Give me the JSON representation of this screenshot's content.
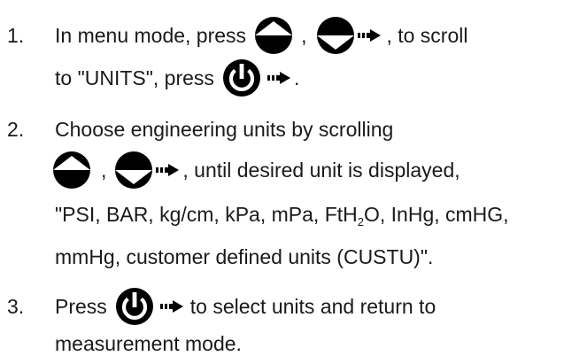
{
  "steps": [
    {
      "number": "1.",
      "line1": {
        "text_a": "In menu mode, press",
        "sep": ",",
        "text_b": ", to scroll"
      },
      "line2": {
        "text_a": "to \"UNITS\", press",
        "text_b": "."
      }
    },
    {
      "number": "2.",
      "line1": {
        "text_a": "Choose engineering units by scrolling"
      },
      "line2": {
        "sep": ",",
        "text_b": ", until desired unit is displayed,"
      },
      "line3": {
        "text_a": "\"PSI, BAR, kg/cm, kPa, mPa, FtH",
        "sub": "2",
        "text_b": "O, InHg, cmHG,"
      },
      "line4": {
        "text_a": "mmHg, customer defined units (CUSTU)\"."
      }
    },
    {
      "number": "3.",
      "line1": {
        "text_a": "Press",
        "text_b": "to select units and return to"
      },
      "line2": {
        "text_a": "measurement mode."
      }
    }
  ],
  "icons": {
    "up": "up-button-icon",
    "down": "down-button-icon",
    "power": "power-button-icon",
    "arrow": "dotted-arrow-icon"
  },
  "colors": {
    "text": "#1a1a1a",
    "icon": "#000000"
  }
}
